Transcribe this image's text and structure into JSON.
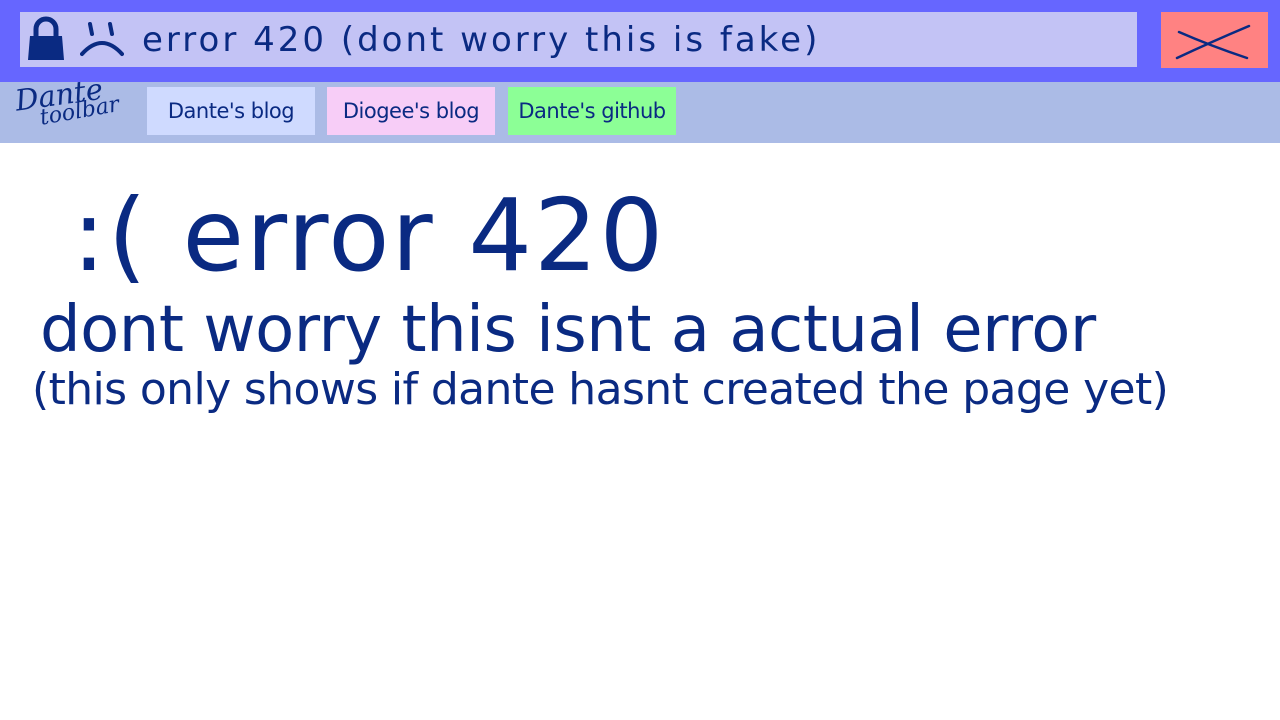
{
  "addressbar": {
    "text": "error 420 (dont worry this is fake)",
    "lock_icon": "lock-icon",
    "status_icon": "sad-face-icon"
  },
  "window": {
    "close_icon": "close-x-icon",
    "colors": {
      "titlebar": "#6666ff",
      "urlbar": "#c3c3f5",
      "close": "#ff8282",
      "text": "#0a2a82"
    }
  },
  "toolbar": {
    "logo_line1": "Dante",
    "logo_line2": "toolbar",
    "tabs": [
      {
        "label": "Dante's blog",
        "color": "#cfdaff"
      },
      {
        "label": "Diogee's blog",
        "color": "#f7cdf7"
      },
      {
        "label": "Dante's github",
        "color": "#8cff96"
      }
    ],
    "background": "#abbbe6"
  },
  "main": {
    "error_heading": ":( error 420",
    "subtitle": "dont worry this isnt a actual error",
    "note": "(this only shows if dante hasnt created the page yet)"
  }
}
